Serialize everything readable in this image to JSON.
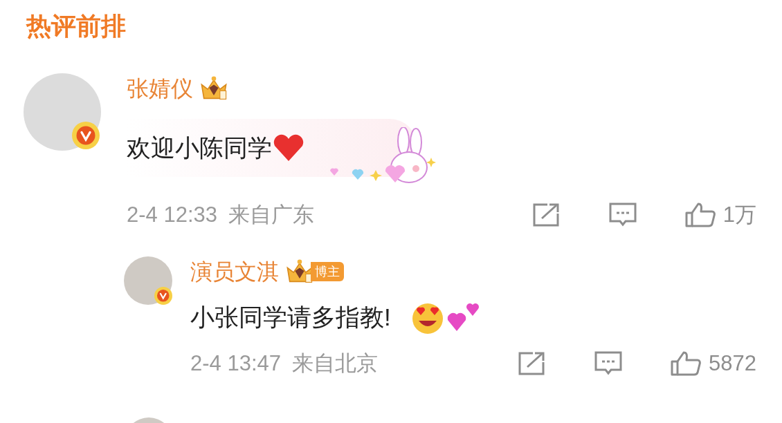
{
  "section_title": "热评前排",
  "comments": [
    {
      "author": "张婧仪",
      "verified": true,
      "text": "欢迎小陈同学",
      "time": "2-4 12:33",
      "location": "来自广东",
      "likes": "1万",
      "replies": [
        {
          "author": "演员文淇",
          "verified": true,
          "author_tag": "博主",
          "text": "小张同学请多指教!",
          "time": "2-4 13:47",
          "location": "来自北京",
          "likes": "5872"
        }
      ]
    }
  ]
}
